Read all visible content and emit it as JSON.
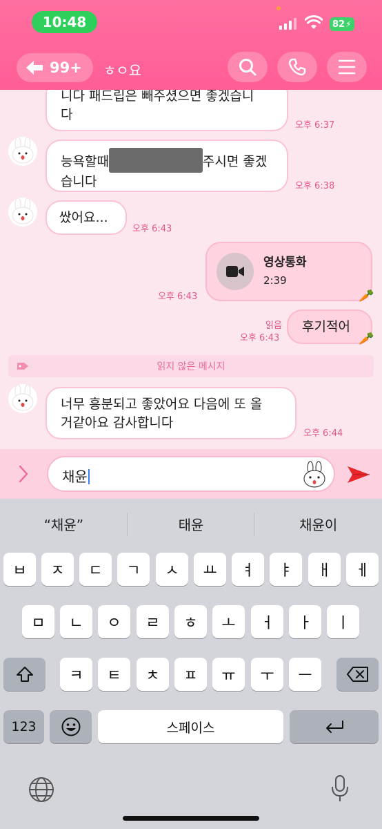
{
  "status": {
    "time": "10:48",
    "battery": "82"
  },
  "header": {
    "back_count": "99+",
    "room_title": "ㅎㅇ요"
  },
  "messages": [
    {
      "line1": "니다 패드립은 빼주셨으면 좋겠습니",
      "line2": "다",
      "time": "오후 6:37"
    },
    {
      "line1_start": "능욕할때",
      "line1_end": "주시면 좋겠",
      "line2": "습니다",
      "time": "오후 6:38"
    },
    {
      "text": "쌌어요...",
      "time": "오후 6:43"
    },
    {
      "title": "영상통화",
      "duration": "2:39",
      "time": "오후 6:43"
    },
    {
      "text": "후기적어",
      "read": "읽음",
      "time": "오후 6:43"
    },
    {
      "line1": "너무 흥분되고 좋았어요 다음에 또 올",
      "line2": "거같아요 감사합니다",
      "time": "오후 6:44"
    }
  ],
  "unread_divider": "읽지 않은 메시지",
  "input": {
    "value": "채윤"
  },
  "keyboard": {
    "suggestions": [
      "“채윤”",
      "태윤",
      "채윤이"
    ],
    "row1": [
      "ㅂ",
      "ㅈ",
      "ㄷ",
      "ㄱ",
      "ㅅ",
      "ㅛ",
      "ㅕ",
      "ㅑ",
      "ㅐ",
      "ㅔ"
    ],
    "row2": [
      "ㅁ",
      "ㄴ",
      "ㅇ",
      "ㄹ",
      "ㅎ",
      "ㅗ",
      "ㅓ",
      "ㅏ",
      "ㅣ"
    ],
    "row3": [
      "ㅋ",
      "ㅌ",
      "ㅊ",
      "ㅍ",
      "ㅠ",
      "ㅜ",
      "ㅡ"
    ],
    "numbers_label": "123",
    "space_label": "스페이스"
  },
  "colors": {
    "header": "#ff5d96",
    "accent": "#e3568a",
    "send": "#e8262b"
  }
}
